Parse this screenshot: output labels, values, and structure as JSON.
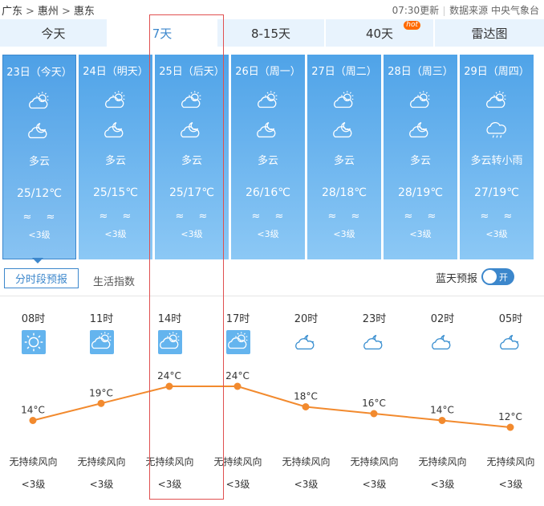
{
  "breadcrumb": [
    "广东",
    ">",
    "惠州",
    ">",
    "惠东"
  ],
  "update_time": "07:30更新",
  "source": "数据来源 中央气象台",
  "tabs": [
    {
      "label": "今天"
    },
    {
      "label": "7天"
    },
    {
      "label": "8-15天"
    },
    {
      "label": "40天",
      "badge": "hot"
    },
    {
      "label": "雷达图"
    }
  ],
  "days": [
    {
      "date": "23日（今天）",
      "icon1": "partly-cloudy-day-icon",
      "icon2": "partly-cloudy-night-icon",
      "weather": "多云",
      "temp": "25/12℃",
      "wind": "≈ ≈",
      "level": "<3级"
    },
    {
      "date": "24日（明天）",
      "icon1": "partly-cloudy-day-icon",
      "icon2": "partly-cloudy-night-icon",
      "weather": "多云",
      "temp": "25/15℃",
      "wind": "≈ ≈",
      "level": "<3级"
    },
    {
      "date": "25日（后天）",
      "icon1": "partly-cloudy-day-icon",
      "icon2": "partly-cloudy-night-icon",
      "weather": "多云",
      "temp": "25/17℃",
      "wind": "≈ ≈",
      "level": "<3级"
    },
    {
      "date": "26日（周一）",
      "icon1": "partly-cloudy-day-icon",
      "icon2": "partly-cloudy-night-icon",
      "weather": "多云",
      "temp": "26/16℃",
      "wind": "≈ ≈",
      "level": "<3级"
    },
    {
      "date": "27日（周二）",
      "icon1": "partly-cloudy-day-icon",
      "icon2": "partly-cloudy-night-icon",
      "weather": "多云",
      "temp": "28/18℃",
      "wind": "≈ ≈",
      "level": "<3级"
    },
    {
      "date": "28日（周三）",
      "icon1": "partly-cloudy-day-icon",
      "icon2": "partly-cloudy-night-icon",
      "weather": "多云",
      "temp": "28/19℃",
      "wind": "≈ ≈",
      "level": "<3级"
    },
    {
      "date": "29日（周四）",
      "icon1": "partly-cloudy-day-icon",
      "icon2": "rain-cloud-icon",
      "weather": "多云转小雨",
      "temp": "27/19℃",
      "wind": "≈ ≈",
      "level": "<3级"
    }
  ],
  "subtabs": {
    "hourly": "分时段预报",
    "life": "生活指数"
  },
  "bluesky": {
    "label": "蓝天预报",
    "toggle": "开"
  },
  "hourly": [
    {
      "time": "08时",
      "icon": "sunny-icon",
      "temp": "14°C",
      "wind": "无持续风向",
      "level": "<3级"
    },
    {
      "time": "11时",
      "icon": "partly-cloudy-day-icon",
      "temp": "19°C",
      "wind": "无持续风向",
      "level": "<3级"
    },
    {
      "time": "14时",
      "icon": "partly-cloudy-day-icon",
      "temp": "24°C",
      "wind": "无持续风向",
      "level": "<3级"
    },
    {
      "time": "17时",
      "icon": "partly-cloudy-day-icon",
      "temp": "24°C",
      "wind": "无持续风向",
      "level": "<3级"
    },
    {
      "time": "20时",
      "icon": "night-cloud-icon",
      "temp": "18°C",
      "wind": "无持续风向",
      "level": "<3级"
    },
    {
      "time": "23时",
      "icon": "night-cloud-icon",
      "temp": "16°C",
      "wind": "无持续风向",
      "level": "<3级"
    },
    {
      "time": "02时",
      "icon": "night-cloud-icon",
      "temp": "14°C",
      "wind": "无持续风向",
      "level": "<3级"
    },
    {
      "time": "05时",
      "icon": "night-cloud-icon",
      "temp": "12°C",
      "wind": "无持续风向",
      "level": "<3级"
    }
  ],
  "chart_data": {
    "type": "line",
    "x": [
      "08时",
      "11时",
      "14时",
      "17时",
      "20时",
      "23时",
      "02时",
      "05时"
    ],
    "series": [
      {
        "values": [
          14,
          19,
          24,
          24,
          18,
          16,
          14,
          12
        ]
      }
    ],
    "color": "#f28a2e"
  },
  "colors": {
    "card_top": "#4fa3e8",
    "card_bottom": "#8cc8f5",
    "accent": "#3c87cc",
    "line": "#f28a2e",
    "highlight_box": "#e05050"
  }
}
